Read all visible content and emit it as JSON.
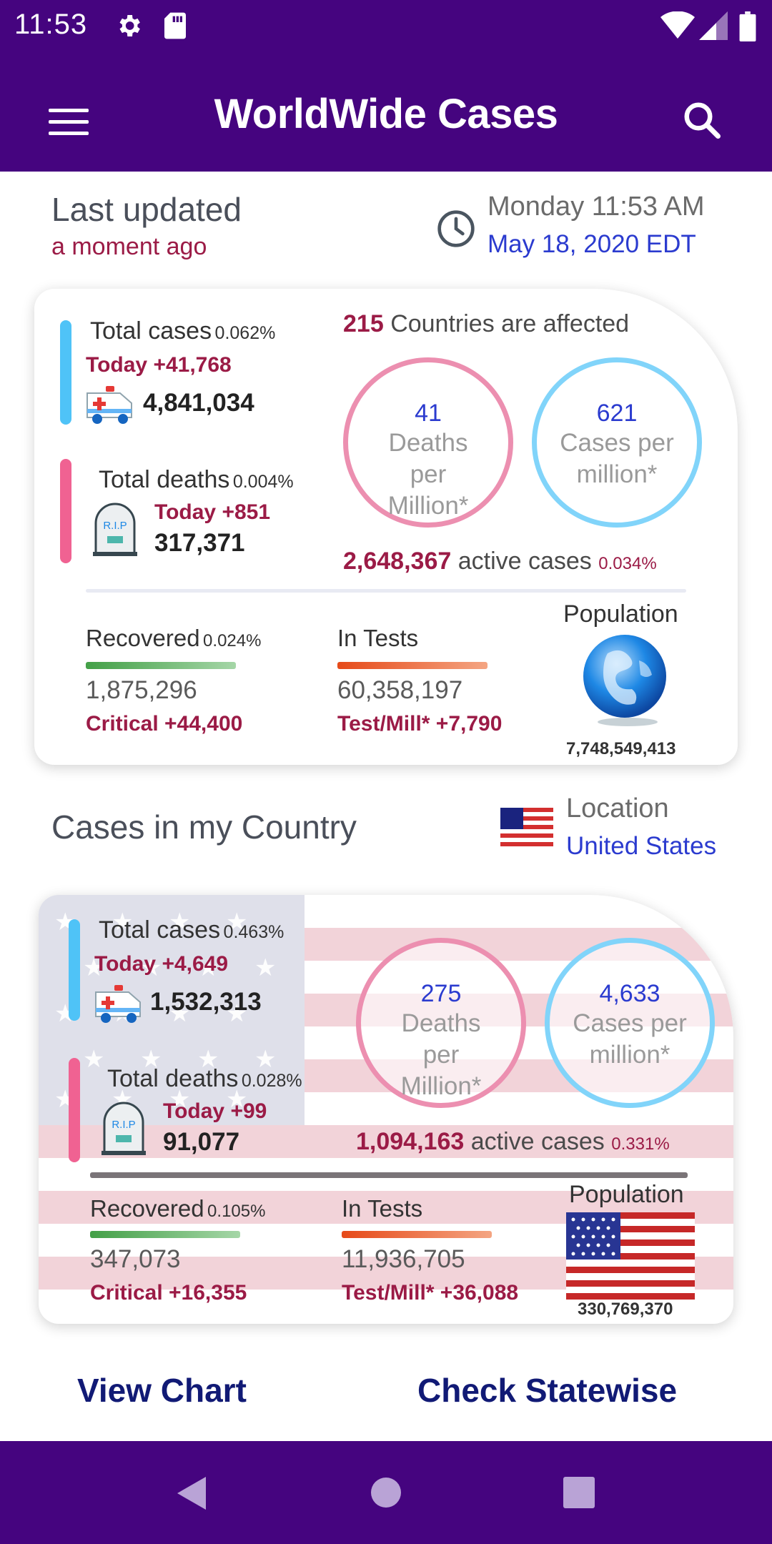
{
  "status_bar": {
    "time": "11:53"
  },
  "app_bar": {
    "title": "WorldWide Cases"
  },
  "last_updated": {
    "label": "Last updated",
    "relative": "a moment ago",
    "day_time": "Monday 11:53 AM",
    "date": "May 18, 2020 EDT"
  },
  "world": {
    "total_cases_label": "Total cases",
    "total_cases_pct": "0.062%",
    "total_cases_today": "Today +41,768",
    "total_cases": "4,841,034",
    "total_deaths_label": "Total deaths",
    "total_deaths_pct": "0.004%",
    "total_deaths_today": "Today +851",
    "total_deaths": "317,371",
    "countries_count": "215",
    "countries_text": "Countries are affected",
    "deaths_per_million": "41",
    "deaths_per_million_label": "Deaths per Million*",
    "cases_per_million": "621",
    "cases_per_million_label": "Cases per million*",
    "active_cases": "2,648,367",
    "active_cases_text": "active cases",
    "active_cases_pct": "0.034%",
    "recovered_label": "Recovered",
    "recovered_pct": "0.024%",
    "recovered": "1,875,296",
    "critical": "Critical +44,400",
    "tests_label": "In Tests",
    "tests": "60,358,197",
    "test_mill": "Test/Mill* +7,790",
    "population_label": "Population",
    "population": "7,748,549,413"
  },
  "country_section": {
    "title": "Cases in my Country",
    "location_label": "Location",
    "location": "United States"
  },
  "country": {
    "total_cases_label": "Total cases",
    "total_cases_pct": "0.463%",
    "total_cases_today": "Today +4,649",
    "total_cases": "1,532,313",
    "total_deaths_label": "Total deaths",
    "total_deaths_pct": "0.028%",
    "total_deaths_today": "Today +99",
    "total_deaths": "91,077",
    "deaths_per_million": "275",
    "deaths_per_million_label": "Deaths per Million*",
    "cases_per_million": "4,633",
    "cases_per_million_label": "Cases per million*",
    "active_cases": "1,094,163",
    "active_cases_text": "active cases",
    "active_cases_pct": "0.331%",
    "recovered_label": "Recovered",
    "recovered_pct": "0.105%",
    "recovered": "347,073",
    "critical": "Critical +16,355",
    "tests_label": "In Tests",
    "tests": "11,936,705",
    "test_mill": "Test/Mill* +36,088",
    "population_label": "Population",
    "population": "330,769,370"
  },
  "actions": {
    "view_chart": "View Chart",
    "check_statewise": "Check Statewise"
  },
  "colors": {
    "primary": "#45047f",
    "accent_red": "#9b1b46",
    "link_blue": "#2b3bcf",
    "cases_bar": "#4fc3f7",
    "deaths_bar": "#f06292"
  },
  "icons": {
    "status": [
      "gear-icon",
      "sd-card-icon",
      "wifi-icon",
      "signal-icon",
      "battery-icon"
    ],
    "app_bar": [
      "menu-icon",
      "search-icon"
    ],
    "nav": [
      "back-icon",
      "home-icon",
      "recents-icon"
    ]
  }
}
